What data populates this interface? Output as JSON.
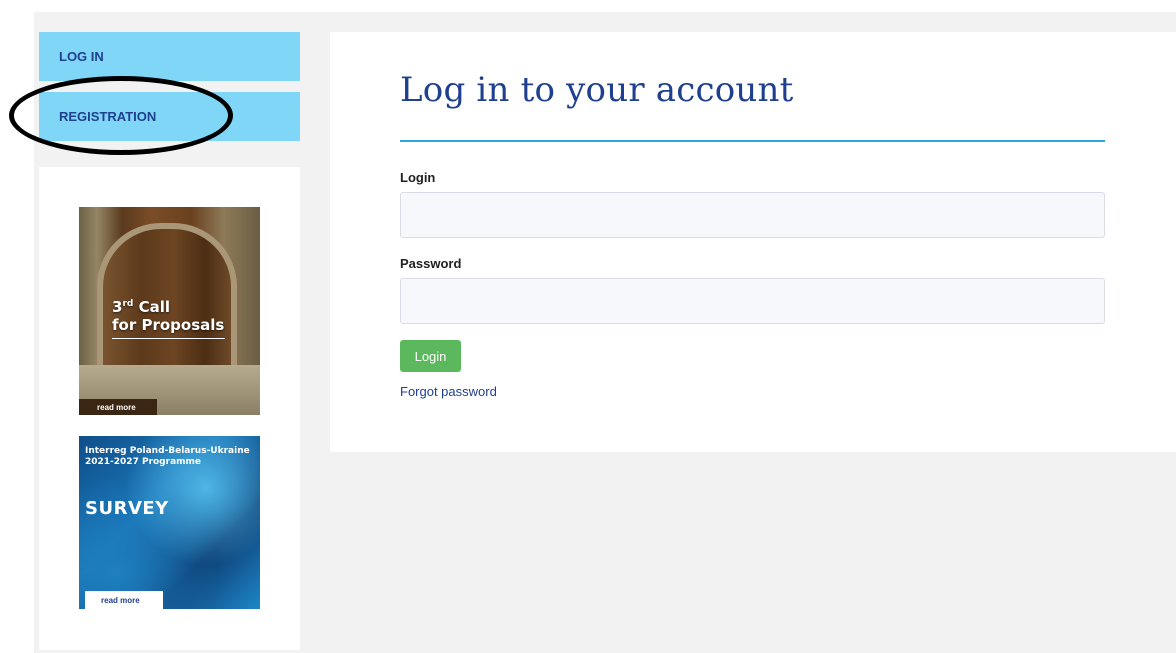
{
  "sidebar": {
    "login_label": "LOG IN",
    "registration_label": "REGISTRATION"
  },
  "banners": {
    "call": {
      "number": "3",
      "superscript": "rd",
      "word_call": "Call",
      "line2": "for Proposals",
      "read_more": "read more"
    },
    "survey": {
      "program_line1": "Interreg Poland-Belarus-Ukraine",
      "program_line2": "2021-2027 Programme",
      "title": "SURVEY",
      "read_more": "read more"
    }
  },
  "form": {
    "title": "Log in to your account",
    "login_label": "Login",
    "login_value": "",
    "password_label": "Password",
    "password_value": "",
    "submit_label": "Login",
    "forgot_label": "Forgot password"
  },
  "colors": {
    "nav_bg": "#7fd6f7",
    "nav_text": "#1f3f8f",
    "title": "#1f3f8f",
    "rule": "#29a8e0",
    "submit_bg": "#5cb85c",
    "page_bg": "#f2f2f2"
  }
}
